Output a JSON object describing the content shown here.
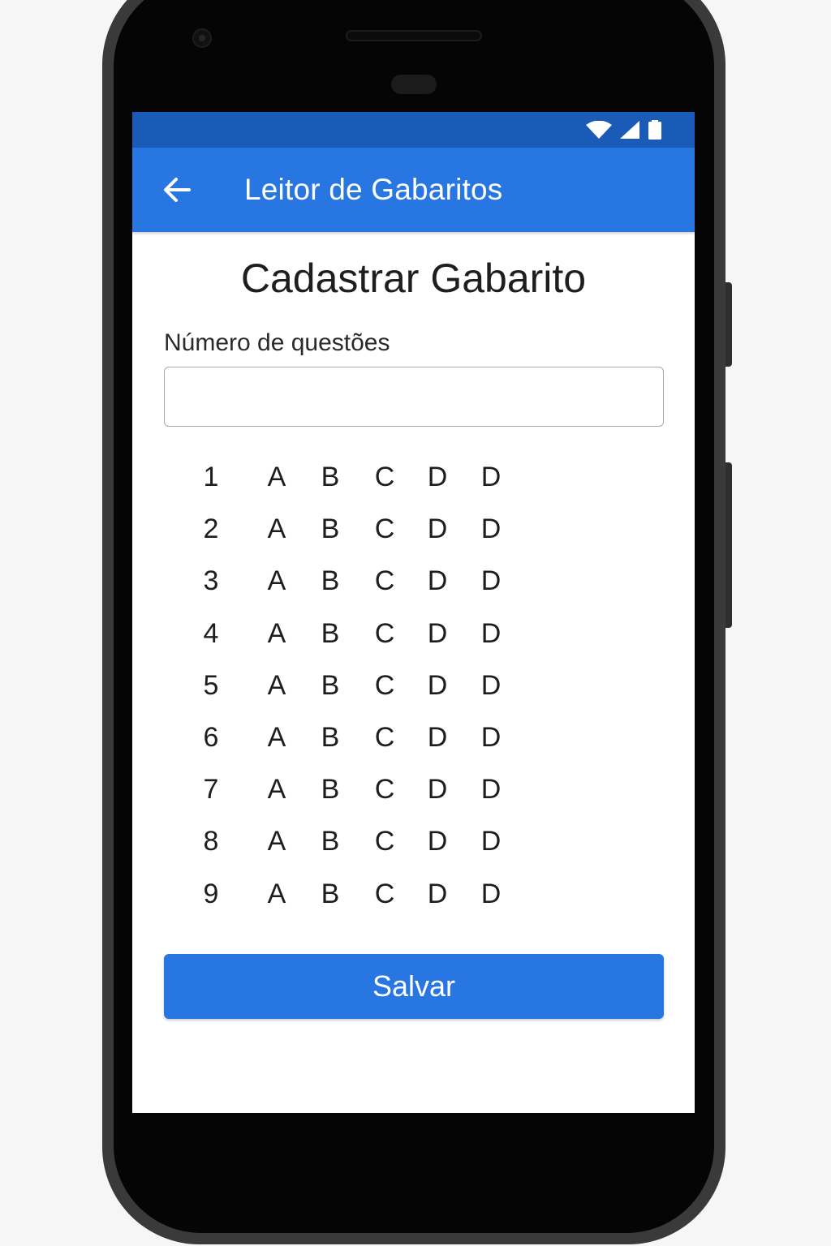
{
  "app_bar": {
    "title": "Leitor de Gabaritos",
    "back_icon": "arrow-left-icon"
  },
  "status_bar": {
    "icons": [
      "wifi-icon",
      "signal-icon",
      "battery-icon"
    ]
  },
  "form": {
    "page_title": "Cadastrar Gabarito",
    "questions_label": "Número de questões",
    "questions_value": ""
  },
  "answer_grid": {
    "rows": [
      {
        "number": "1",
        "options": [
          "A",
          "B",
          "C",
          "D",
          "D"
        ]
      },
      {
        "number": "2",
        "options": [
          "A",
          "B",
          "C",
          "D",
          "D"
        ]
      },
      {
        "number": "3",
        "options": [
          "A",
          "B",
          "C",
          "D",
          "D"
        ]
      },
      {
        "number": "4",
        "options": [
          "A",
          "B",
          "C",
          "D",
          "D"
        ]
      },
      {
        "number": "5",
        "options": [
          "A",
          "B",
          "C",
          "D",
          "D"
        ]
      },
      {
        "number": "6",
        "options": [
          "A",
          "B",
          "C",
          "D",
          "D"
        ]
      },
      {
        "number": "7",
        "options": [
          "A",
          "B",
          "C",
          "D",
          "D"
        ]
      },
      {
        "number": "8",
        "options": [
          "A",
          "B",
          "C",
          "D",
          "D"
        ]
      },
      {
        "number": "9",
        "options": [
          "A",
          "B",
          "C",
          "D",
          "D"
        ]
      }
    ]
  },
  "actions": {
    "save_label": "Salvar"
  },
  "colors": {
    "primary": "#2776e2",
    "status_bar": "#1a5bb8",
    "text": "#1e1e1e"
  }
}
